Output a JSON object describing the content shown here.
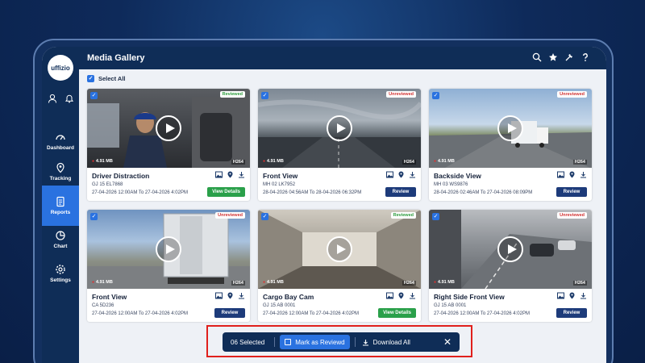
{
  "app": {
    "logo_text": "uffizio",
    "header_title": "Media Gallery"
  },
  "sidebar": {
    "items": [
      {
        "label": "Dashboard",
        "icon": "speedometer-icon",
        "active": false
      },
      {
        "label": "Tracking",
        "icon": "location-pin-icon",
        "active": false
      },
      {
        "label": "Reports",
        "icon": "report-icon",
        "active": true
      },
      {
        "label": "Chart",
        "icon": "pie-chart-icon",
        "active": false
      },
      {
        "label": "Settings",
        "icon": "gear-icon",
        "active": false
      }
    ]
  },
  "gallery": {
    "select_all_label": "Select All"
  },
  "cards": [
    {
      "title": "Driver Distraction",
      "plate": "GJ 15 EL7868",
      "date": "27-04-2026  12:00AM To 27-04-2026  4:02PM",
      "size": "4.91 MB",
      "codec": "H264",
      "status": "Reviewed",
      "button": "View Details",
      "button_type": "viewed"
    },
    {
      "title": "Front View",
      "plate": "MH 02 LK7952",
      "date": "28-04-2026  04:56AM To 28-04-2026  06:32PM",
      "size": "4.91 MB",
      "codec": "H264",
      "status": "Unreviewed",
      "button": "Review",
      "button_type": "review"
    },
    {
      "title": "Backside View",
      "plate": "MH 03 WS9876",
      "date": "28-04-2026  02:46AM To 27-04-2026  08:09PM",
      "size": "4.91 MB",
      "codec": "H264",
      "status": "Unreviewed",
      "button": "Review",
      "button_type": "review"
    },
    {
      "title": "Front View",
      "plate": "CA 5D236",
      "date": "27-04-2026  12:00AM To 27-04-2026  4:02PM",
      "size": "4.91 MB",
      "codec": "H264",
      "status": "Unreviewed",
      "button": "Review",
      "button_type": "review"
    },
    {
      "title": "Cargo Bay Cam",
      "plate": "GJ 15 AB 0001",
      "date": "27-04-2026  12:00AM To 27-04-2026  4:02PM",
      "size": "4.91 MB",
      "codec": "H264",
      "status": "Reviewed",
      "button": "View Details",
      "button_type": "viewed"
    },
    {
      "title": "Right Side Front View",
      "plate": "GJ 15 AB 0001",
      "date": "27-04-2026  12:00AM To 27-04-2026  4:02PM",
      "size": "4.91 MB",
      "codec": "H264",
      "status": "Unreviewed",
      "button": "Review",
      "button_type": "review"
    }
  ],
  "action_bar": {
    "selected": "06 Selected",
    "mark_label": "Mark as Reviewd",
    "download_label": "Download All"
  },
  "colors": {
    "navy": "#0f2d57",
    "accent": "#2a72e0",
    "reviewed": "#2aa04a",
    "unreviewed": "#d03030",
    "highlight": "#e0201c"
  }
}
